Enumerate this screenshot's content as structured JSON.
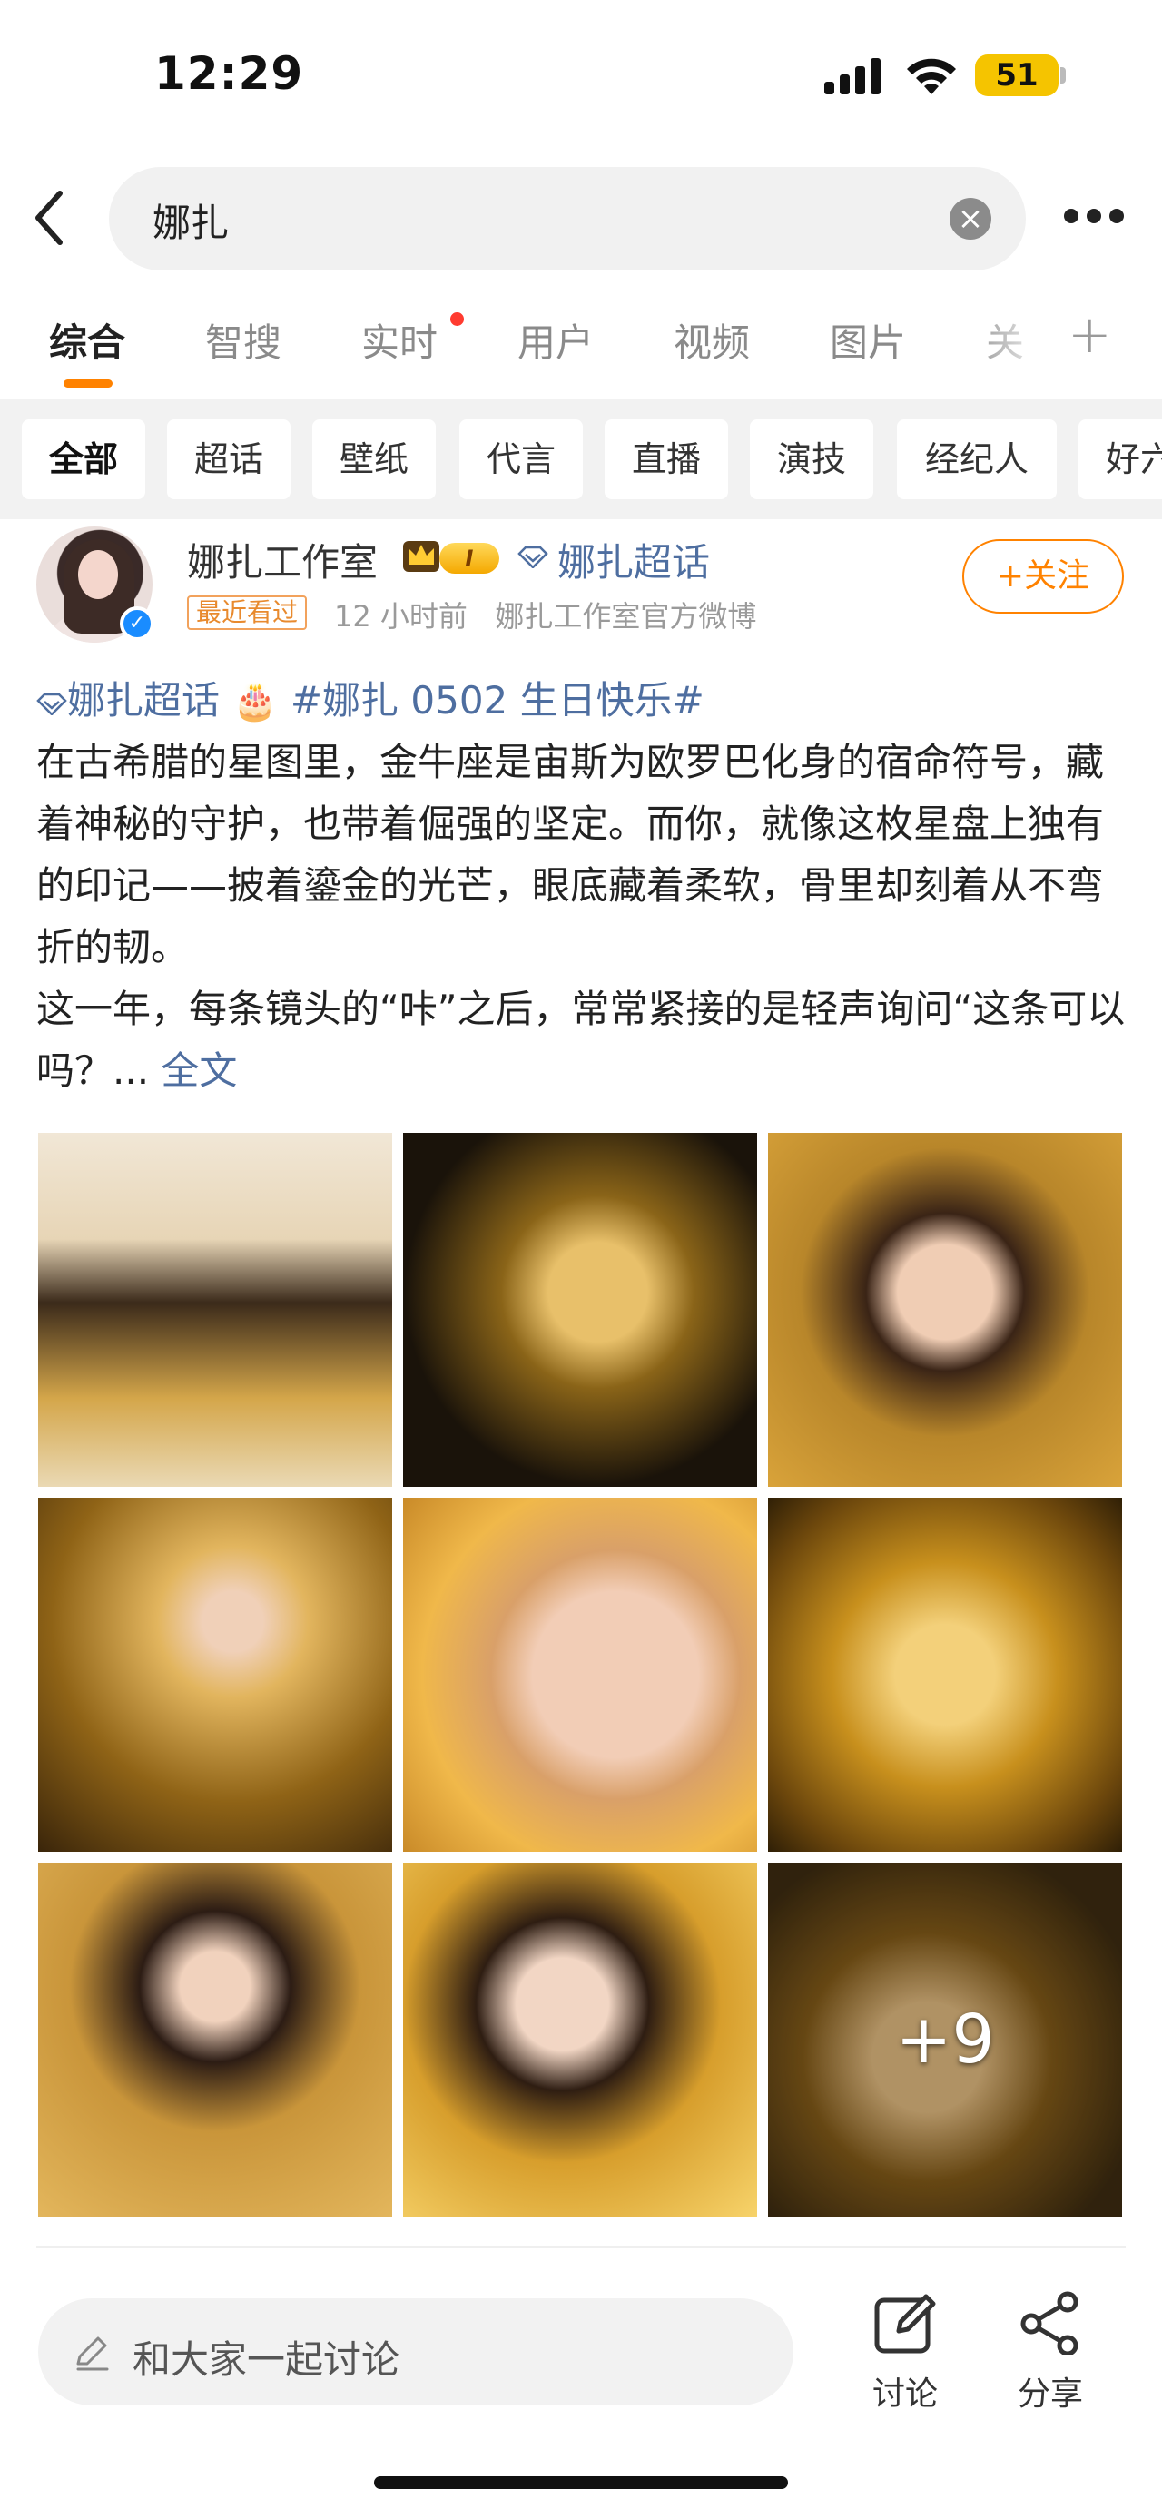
{
  "status_bar": {
    "time": "12:29",
    "battery": "51"
  },
  "search": {
    "query": "娜扎"
  },
  "tabs": [
    {
      "label": "综合",
      "active": true
    },
    {
      "label": "智搜"
    },
    {
      "label": "实时",
      "dot": true
    },
    {
      "label": "用户"
    },
    {
      "label": "视频"
    },
    {
      "label": "图片"
    },
    {
      "label": "关"
    }
  ],
  "chips": [
    "全部",
    "超话",
    "壁纸",
    "代言",
    "直播",
    "演技",
    "经纪人",
    "好六"
  ],
  "post": {
    "username": "娜扎工作室",
    "vip_level": "I",
    "supertopic": "娜扎超话",
    "recent_badge": "最近看过",
    "meta": "12 小时前   娜扎工作室官方微博",
    "follow_label": "+关注",
    "topic1": "娜扎超话",
    "topic2": "#娜扎 0502 生日快乐#",
    "body_line1": "在古希腊的星图里，金牛座是宙斯为欧罗巴化身的宿命符号，藏着神秘的守护，也带着倔强的坚定。而你，就像这枚星盘上独有的印记——披着鎏金的光芒，眼底藏着柔软，骨里却刻着从不弯折的韧。",
    "body_line2": "这一年，每条镜头的“咔”之后，常常紧接的是轻声询问“这条可以吗？...",
    "full_text_label": "全文",
    "more_count": "+9"
  },
  "bottom": {
    "comment_placeholder": "和大家一起讨论",
    "discuss_label": "讨论",
    "share_label": "分享"
  },
  "colors": {
    "accent": "#ff8200",
    "link": "#4e6ea0",
    "verified": "#1a8cff",
    "battery": "#f5c400"
  }
}
